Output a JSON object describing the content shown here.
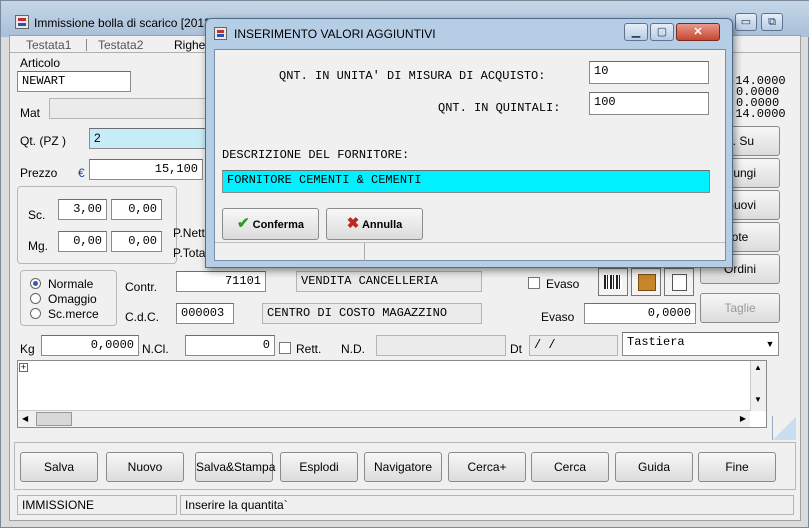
{
  "main_window": {
    "title": "Immissione bolla di scarico [2013",
    "tabs": [
      "Testata1",
      "Testata2",
      "Righe"
    ],
    "articolo_label": "Articolo",
    "articolo_value": "NEWART",
    "mat_label": "Mat",
    "qt_label": "Qt.  (PZ )",
    "qt_value": "2",
    "prezzo_label": "Prezzo",
    "currency_symbol": "€",
    "prezzo_value": "15,100",
    "sc_label": "Sc.",
    "sc_values": [
      "3,00",
      "0,00"
    ],
    "mg_label": "Mg.",
    "mg_values": [
      "0,00",
      "0,00"
    ],
    "pnetto_label": "P.Nett",
    "ptotale_label": "P.Tota",
    "right_numbers": [
      "-14.0000",
      "0.0000",
      "0.0000",
      "-14.0000"
    ],
    "side_buttons": [
      "g. Su",
      "giungi",
      "muovi",
      "ote",
      "Ordini",
      "Taglie"
    ],
    "radio_options": [
      "Normale",
      "Omaggio",
      "Sc.merce"
    ],
    "radio_selected": "Normale",
    "contr_label": "Contr.",
    "contr_code": "71101",
    "contr_desc": "VENDITA CANCELLERIA",
    "evaso_check_label": "Evaso",
    "cdc_label": "C.d.C.",
    "cdc_code": "000003",
    "cdc_desc": "CENTRO DI COSTO MAGAZZINO",
    "evaso_label": "Evaso",
    "evaso_value": "0,0000",
    "kg_label": "Kg",
    "kg_value": "0,0000",
    "ncl_label": "N.Cl.",
    "ncl_value": "0",
    "rett_label": "Rett.",
    "nd_label": "N.D.",
    "dt_label": "Dt",
    "dt_value": " /  /",
    "tastiera_value": "Tastiera",
    "bottom_buttons": [
      "Salva",
      "Nuovo",
      "Salva&Stampa",
      "Esplodi",
      "Navigatore",
      "Cerca+",
      "Cerca",
      "Guida",
      "Fine"
    ],
    "status_mode": "IMMISSIONE",
    "status_message": "Inserire la quantita`"
  },
  "dialog": {
    "title": "INSERIMENTO VALORI AGGIUNTIVI",
    "qnt_acquisto_label": "QNT. IN UNITA' DI MISURA DI ACQUISTO:",
    "qnt_acquisto_value": "10",
    "qnt_quintali_label": "QNT. IN QUINTALI:",
    "qnt_quintali_value": "100",
    "descr_label": "DESCRIZIONE DEL FORNITORE:",
    "descr_value": "FORNITORE CEMENTI & CEMENTI",
    "confirm_label": "Conferma",
    "cancel_label": "Annulla"
  },
  "colors": {
    "accent_cyan": "#00f0ff",
    "qt_field_blue": "#c6ecf7",
    "title_bar": "#b6cde6"
  }
}
